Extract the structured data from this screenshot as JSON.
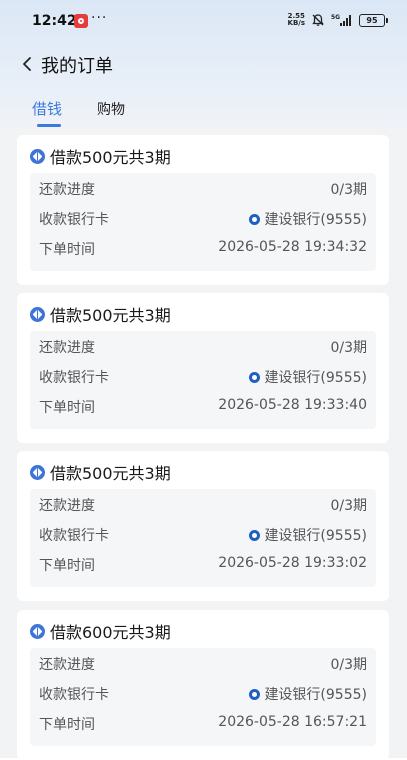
{
  "status_bar": {
    "time": "12:42",
    "app_icon": "weibo-like-red-icon",
    "more": "···",
    "net_speed_value": "2.55",
    "net_speed_unit": "KB/s",
    "battery": "95",
    "icons": [
      "bell-muted-icon",
      "5g-signal-icon"
    ]
  },
  "header": {
    "title": "我的订单",
    "back_icon": "chevron-left-icon"
  },
  "tabs": [
    {
      "label": "借钱",
      "active": true
    },
    {
      "label": "购物",
      "active": false
    }
  ],
  "accent_color": "#3d7ae0",
  "orders": [
    {
      "title": "借款500元共3期",
      "rows": [
        {
          "label": "还款进度",
          "value": "0/3期"
        },
        {
          "label": "收款银行卡",
          "value": "建设银行(9555)"
        },
        {
          "label": "下单时间",
          "value": "2026-05-28 19:34:32"
        }
      ]
    },
    {
      "title": "借款500元共3期",
      "rows": [
        {
          "label": "还款进度",
          "value": "0/3期"
        },
        {
          "label": "收款银行卡",
          "value": "建设银行(9555)"
        },
        {
          "label": "下单时间",
          "value": "2026-05-28 19:33:40"
        }
      ]
    },
    {
      "title": "借款500元共3期",
      "rows": [
        {
          "label": "还款进度",
          "value": "0/3期"
        },
        {
          "label": "收款银行卡",
          "value": "建设银行(9555)"
        },
        {
          "label": "下单时间",
          "value": "2026-05-28 19:33:02"
        }
      ]
    },
    {
      "title": "借款600元共3期",
      "rows": [
        {
          "label": "还款进度",
          "value": "0/3期"
        },
        {
          "label": "收款银行卡",
          "value": "建设银行(9555)"
        },
        {
          "label": "下单时间",
          "value": "2026-05-28 16:57:21"
        }
      ]
    }
  ]
}
